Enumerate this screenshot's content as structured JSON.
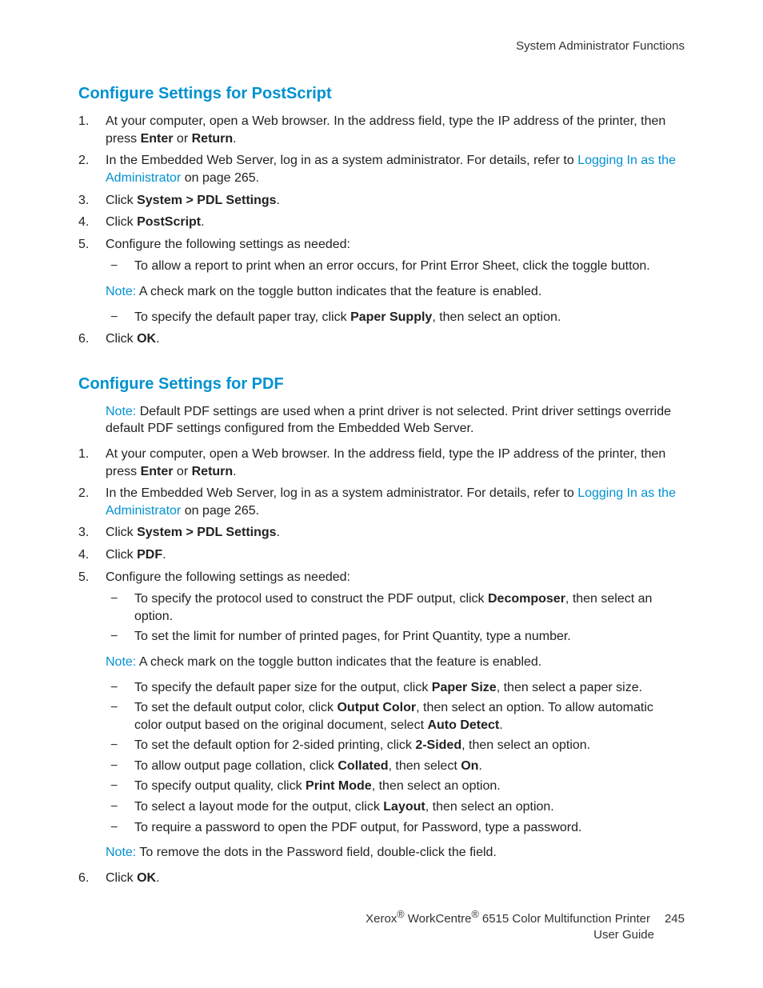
{
  "header": {
    "section": "System Administrator Functions"
  },
  "sections": {
    "postscript": {
      "heading": "Configure Settings for PostScript",
      "steps": {
        "s1a": "At your computer, open a Web browser. In the address field, type the IP address of the printer, then press ",
        "s1b": "Enter",
        "s1c": " or ",
        "s1d": "Return",
        "s1e": ".",
        "s2a": "In the Embedded Web Server, log in as a system administrator. For details, refer to ",
        "s2link": "Logging In as the Administrator",
        "s2b": " on page 265.",
        "s3a": "Click ",
        "s3b": "System > PDL Settings",
        "s3c": ".",
        "s4a": "Click ",
        "s4b": "PostScript",
        "s4c": ".",
        "s5": "Configure the following settings as needed:",
        "s5_b1": "To allow a report to print when an error occurs, for Print Error Sheet, click the toggle button.",
        "s5_noteLabel": "Note:",
        "s5_noteText": " A check mark on the toggle button indicates that the feature is enabled.",
        "s5_b2a": "To specify the default paper tray, click ",
        "s5_b2b": "Paper Supply",
        "s5_b2c": ", then select an option.",
        "s6a": "Click ",
        "s6b": "OK",
        "s6c": "."
      }
    },
    "pdf": {
      "heading": "Configure Settings for PDF",
      "introNoteLabel": "Note:",
      "introNoteText": " Default PDF settings are used when a print driver is not selected. Print driver settings override default PDF settings configured from the Embedded Web Server.",
      "steps": {
        "s1a": "At your computer, open a Web browser. In the address field, type the IP address of the printer, then press ",
        "s1b": "Enter",
        "s1c": " or ",
        "s1d": "Return",
        "s1e": ".",
        "s2a": "In the Embedded Web Server, log in as a system administrator. For details, refer to ",
        "s2link": "Logging In as the Administrator",
        "s2b": " on page 265.",
        "s3a": "Click ",
        "s3b": "System > PDL Settings",
        "s3c": ".",
        "s4a": "Click ",
        "s4b": "PDF",
        "s4c": ".",
        "s5": "Configure the following settings as needed:",
        "s5_b1a": "To specify the protocol used to construct the PDF output, click ",
        "s5_b1b": "Decomposer",
        "s5_b1c": ", then select an option.",
        "s5_b2": "To set the limit for number of printed pages, for Print Quantity, type a number.",
        "s5_note1Label": "Note:",
        "s5_note1Text": " A check mark on the toggle button indicates that the feature is enabled.",
        "s5_b3a": "To specify the default paper size for the output, click ",
        "s5_b3b": "Paper Size",
        "s5_b3c": ", then select a paper size.",
        "s5_b4a": "To set the default output color, click ",
        "s5_b4b": "Output Color",
        "s5_b4c": ", then select an option. To allow automatic color output based on the original document, select ",
        "s5_b4d": "Auto Detect",
        "s5_b4e": ".",
        "s5_b5a": "To set the default option for 2-sided printing, click ",
        "s5_b5b": "2-Sided",
        "s5_b5c": ", then select an option.",
        "s5_b6a": "To allow output page collation, click ",
        "s5_b6b": "Collated",
        "s5_b6c": ", then select ",
        "s5_b6d": "On",
        "s5_b6e": ".",
        "s5_b7a": "To specify output quality, click ",
        "s5_b7b": "Print Mode",
        "s5_b7c": ", then select an option.",
        "s5_b8a": "To select a layout mode for the output, click ",
        "s5_b8b": "Layout",
        "s5_b8c": ", then select an option.",
        "s5_b9": "To require a password to open the PDF output, for Password, type a password.",
        "s5_note2Label": "Note:",
        "s5_note2Text": " To remove the dots in the Password field, double-click the field.",
        "s6a": "Click ",
        "s6b": "OK",
        "s6c": "."
      }
    }
  },
  "footer": {
    "line1a": "Xerox",
    "line1b": " WorkCentre",
    "line1c": " 6515 Color Multifunction Printer",
    "line2": "User Guide",
    "page": "245",
    "reg": "®"
  }
}
